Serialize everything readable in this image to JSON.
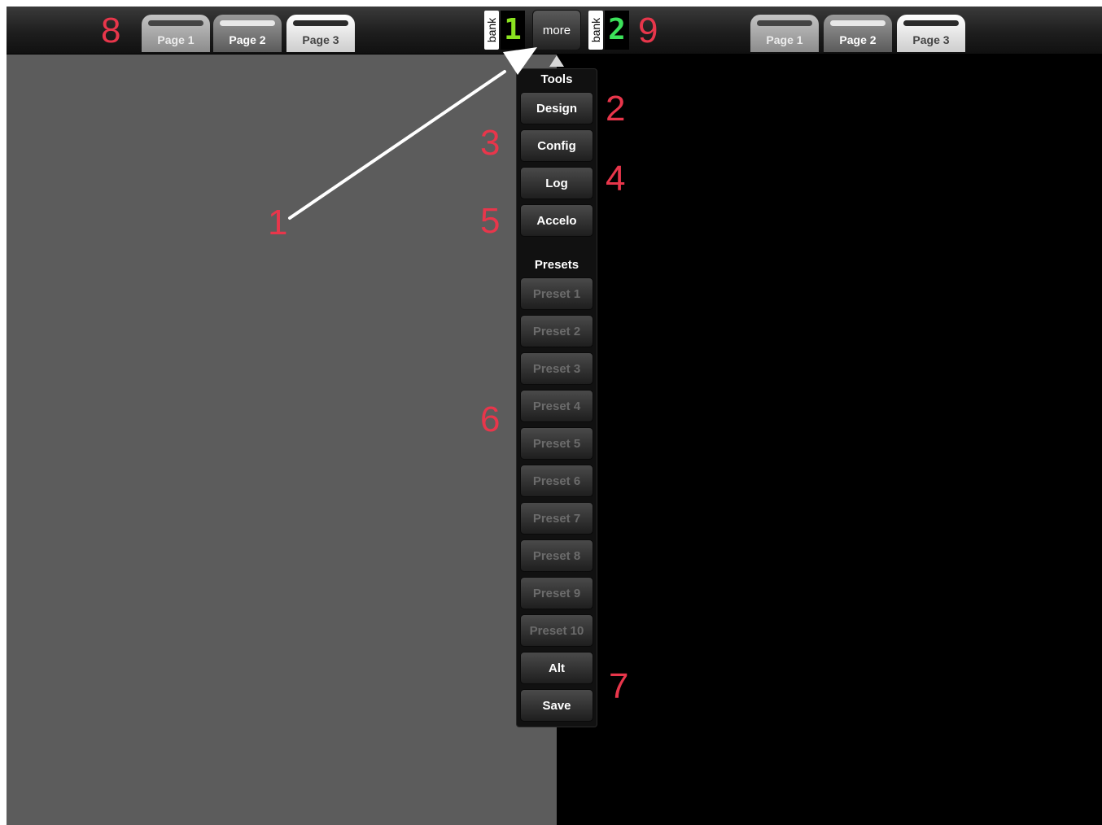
{
  "left_tabs": [
    "Page 1",
    "Page 2",
    "Page 3"
  ],
  "right_tabs": [
    "Page 1",
    "Page 2",
    "Page 3"
  ],
  "bank_left": {
    "label": "bank",
    "digit": "1",
    "digit_color": "#8be320"
  },
  "bank_right": {
    "label": "bank",
    "digit": "2",
    "digit_color": "#3ce15a"
  },
  "more_label": "more",
  "menu": {
    "tools_header": "Tools",
    "tools": [
      "Design",
      "Config",
      "Log",
      "Accelo"
    ],
    "presets_header": "Presets",
    "presets": [
      "Preset 1",
      "Preset 2",
      "Preset 3",
      "Preset 4",
      "Preset 5",
      "Preset 6",
      "Preset 7",
      "Preset 8",
      "Preset 9",
      "Preset 10"
    ],
    "actions": [
      "Alt",
      "Save"
    ]
  },
  "callouts": [
    "1",
    "2",
    "3",
    "4",
    "5",
    "6",
    "7",
    "8",
    "9"
  ],
  "colors": {
    "callout": "#e8364b",
    "left_pane": "#5c5c5c",
    "right_pane": "#000000"
  }
}
